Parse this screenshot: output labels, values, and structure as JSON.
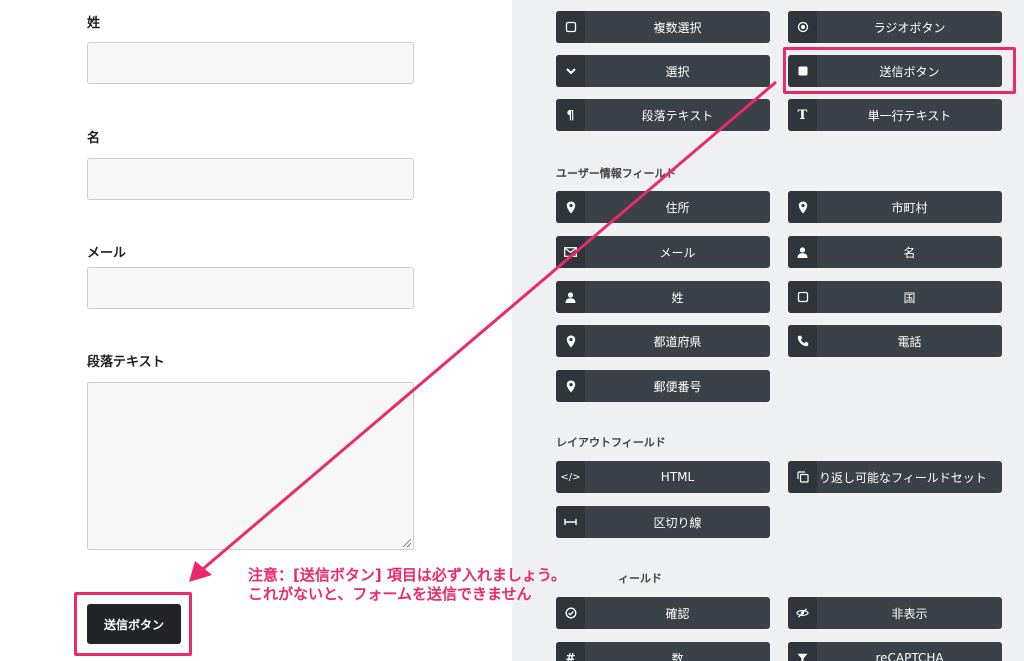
{
  "form": {
    "last_name_label": "姓",
    "first_name_label": "名",
    "email_label": "メール",
    "paragraph_label": "段落テキスト",
    "submit_label": "送信ボタン"
  },
  "panel": {
    "top_fields": [
      {
        "label": "複数選択",
        "icon": "checkbox-icon"
      },
      {
        "label": "ラジオボタン",
        "icon": "radio-icon"
      },
      {
        "label": "選択",
        "icon": "chevron-down-icon"
      },
      {
        "label": "送信ボタン",
        "icon": "square-icon"
      },
      {
        "label": "段落テキスト",
        "icon": "pilcrow-icon"
      },
      {
        "label": "単一行テキスト",
        "icon": "text-icon"
      }
    ],
    "user_info": {
      "title": "ユーザー情報フィールド",
      "fields": [
        {
          "label": "住所",
          "icon": "map-marker-icon"
        },
        {
          "label": "市町村",
          "icon": "map-marker-icon"
        },
        {
          "label": "メール",
          "icon": "envelope-icon"
        },
        {
          "label": "名",
          "icon": "user-icon"
        },
        {
          "label": "姓",
          "icon": "user-icon"
        },
        {
          "label": "国",
          "icon": "square-icon"
        },
        {
          "label": "都道府県",
          "icon": "map-marker-icon"
        },
        {
          "label": "電話",
          "icon": "phone-icon"
        },
        {
          "label": "郵便番号",
          "icon": "map-marker-icon"
        }
      ]
    },
    "layout": {
      "title": "レイアウトフィールド",
      "fields": [
        {
          "label": "HTML",
          "icon": "code-icon"
        },
        {
          "label": "り返し可能なフィールドセット",
          "icon": "copy-icon"
        },
        {
          "label": "区切り線",
          "icon": "divider-icon"
        }
      ]
    },
    "partial_title": "ィールド",
    "bottom_fields": [
      {
        "label": "確認",
        "icon": "check-circle-icon"
      },
      {
        "label": "非表示",
        "icon": "eye-slash-icon"
      },
      {
        "label": "数",
        "icon": "hash-icon"
      },
      {
        "label": "reCAPTCHA",
        "icon": "filter-icon"
      }
    ]
  },
  "annotation": {
    "line1": "注意：[送信ボタン] 項目は必ず入れましょう。",
    "line2": "これがないと、フォームを送信できません",
    "color": "#ea2a6a"
  }
}
